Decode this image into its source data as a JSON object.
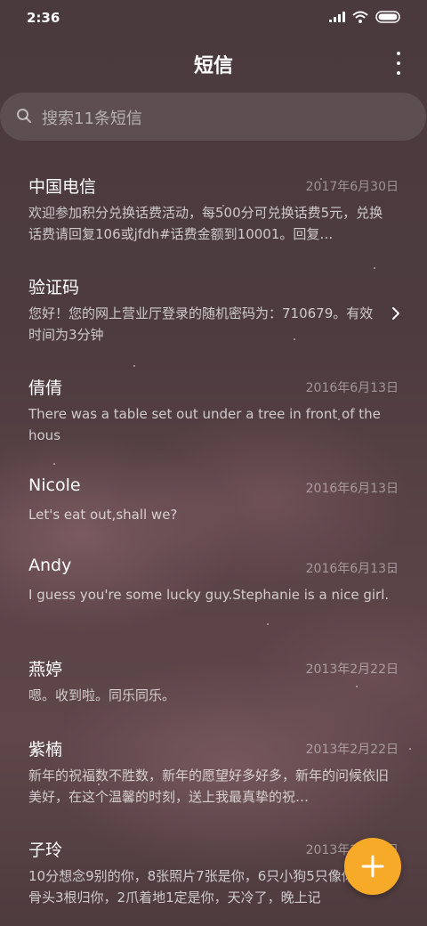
{
  "status": {
    "time": "2:36"
  },
  "header": {
    "title": "短信"
  },
  "search": {
    "placeholder": "搜索11条短信"
  },
  "conversations": [
    {
      "name": "中国电信",
      "date": "2017年6月30日",
      "preview": "欢迎参加积分兑换话费活动，每500分可兑换话费5元，兑换话费请回复106或jfdh#话费金额到10001。回复…"
    },
    {
      "name": "验证码",
      "date": "",
      "preview": "您好！您的网上营业厅登录的随机密码为：710679。有效时间为3分钟"
    },
    {
      "name": "倩倩",
      "date": "2016年6月13日",
      "preview": "There was a table set out under a tree in front of the hous"
    },
    {
      "name": "Nicole",
      "date": "2016年6月13日",
      "preview": "Let's eat out,shall we?"
    },
    {
      "name": "Andy",
      "date": "2016年6月13日",
      "preview": "I guess you're some lucky guy.Stephanie is a nice girl."
    },
    {
      "name": "燕婷",
      "date": "2013年2月22日",
      "preview": "嗯。收到啦。同乐同乐。"
    },
    {
      "name": "紫楠",
      "date": "2013年2月22日",
      "preview": "新年的祝福数不胜数，新年的愿望好多好多，新年的问候依旧美好，在这个温馨的时刻，送上我最真挚的祝…"
    },
    {
      "name": "子玲",
      "date": "2013年2月22日",
      "preview": "10分想念9别的你，8张照片7张是你，6只小狗5只像你，4根骨头3根归你，2爪着地1定是你，天冷了，晚上记"
    }
  ],
  "icons": {
    "signal": "signal-icon",
    "wifi": "wifi-icon",
    "battery": "battery-icon",
    "more": "more-vertical-icon",
    "search": "search-icon",
    "chevron": "chevron-right-icon",
    "compose": "plus-icon"
  },
  "colors": {
    "fab": "#f7a928"
  }
}
